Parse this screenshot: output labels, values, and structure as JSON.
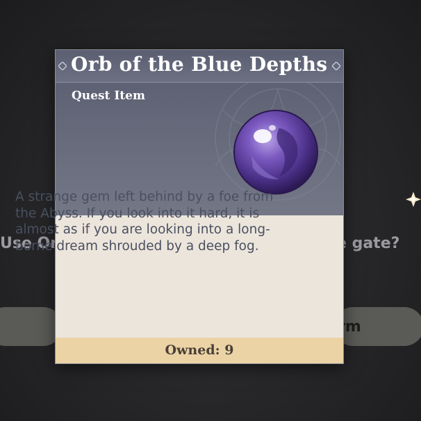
{
  "background": {
    "prompt_left": "Use Or",
    "prompt_right": "e gate?",
    "button_left_label": "",
    "button_right_label": "rm"
  },
  "item_card": {
    "title": "Orb of the Blue Depths",
    "type": "Quest Item",
    "description": "A strange gem left behind by a foe from the Abyss. If you look into it hard, it is almost as if you are looking into a long-borne dream shrouded by a deep fog.",
    "owned_label": "Owned: 9",
    "icon": "purple-orb-icon"
  },
  "colors": {
    "header": "#5d6173",
    "body": "#ece5dc",
    "owned_bar": "#ebd3a6",
    "description_text": "#4a5060"
  }
}
